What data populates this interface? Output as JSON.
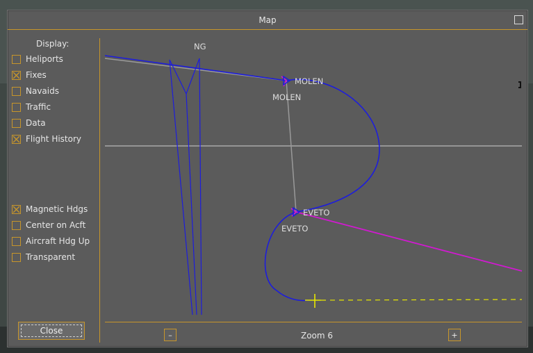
{
  "window": {
    "title": "Map"
  },
  "sidebar": {
    "heading": "Display:",
    "options": [
      {
        "label": "Heliports",
        "checked": false
      },
      {
        "label": "Fixes",
        "checked": true
      },
      {
        "label": "Navaids",
        "checked": false
      },
      {
        "label": "Traffic",
        "checked": false
      },
      {
        "label": "Data",
        "checked": false
      },
      {
        "label": "Flight History",
        "checked": true
      }
    ],
    "settings": [
      {
        "label": "Magnetic Hdgs",
        "checked": true
      },
      {
        "label": "Center on Acft",
        "checked": false
      },
      {
        "label": "Aircraft Hdg Up",
        "checked": false
      },
      {
        "label": "Transparent",
        "checked": false
      }
    ],
    "close_label": "Close"
  },
  "map": {
    "labels": {
      "ng": "NG",
      "molen_a": "MOLEN",
      "molen_b": "MOLEN",
      "eveto_a": "EVETO",
      "eveto_b": "EVETO"
    },
    "colors": {
      "route": "#1d1ddc",
      "history": "#9a9a9a",
      "active_leg": "#d01ad0",
      "aircraft": "#e8e800",
      "accent": "#c8962a"
    }
  },
  "footer": {
    "zoom_out": "–",
    "zoom_label": "Zoom 6",
    "zoom_in": "+"
  }
}
